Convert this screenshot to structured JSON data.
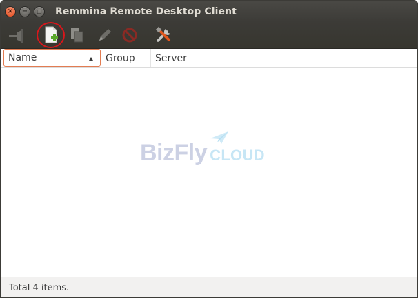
{
  "window": {
    "title": "Remmina Remote Desktop Client",
    "controls": {
      "close": "×",
      "minimize": "−",
      "maximize": "□"
    }
  },
  "toolbar": {
    "buttons": [
      {
        "name": "connect-icon",
        "enabled": false
      },
      {
        "name": "new-file-icon",
        "enabled": true,
        "highlighted": true
      },
      {
        "name": "copy-icon",
        "enabled": false
      },
      {
        "name": "edit-icon",
        "enabled": false
      },
      {
        "name": "delete-icon",
        "enabled": false
      },
      {
        "name": "preferences-icon",
        "enabled": true
      }
    ],
    "highlight_color": "#d8161b"
  },
  "columns": {
    "name": "Name",
    "group": "Group",
    "server": "Server",
    "sorted_by": "Name",
    "sort_direction": "ascending"
  },
  "watermark": {
    "brand": "BizFly",
    "suffix": "CLOUD"
  },
  "status": {
    "text": "Total 4 items."
  },
  "colors": {
    "titlebar": "#3c3b37",
    "close_button": "#e2481b",
    "sort_column_border": "#e27c52"
  }
}
